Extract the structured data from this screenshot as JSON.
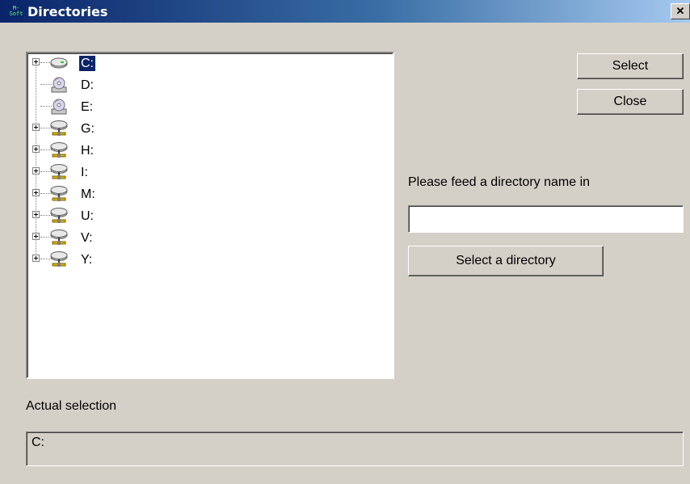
{
  "window": {
    "title": "Directories",
    "app_icon_text": "M-Soft",
    "close_glyph": "✕"
  },
  "tree": {
    "items": [
      {
        "label": "C:",
        "type": "hard-drive",
        "expandable": true,
        "selected": true
      },
      {
        "label": "D:",
        "type": "cd-drive",
        "expandable": false,
        "selected": false
      },
      {
        "label": "E:",
        "type": "cd-drive",
        "expandable": false,
        "selected": false
      },
      {
        "label": "G:",
        "type": "network-drive",
        "expandable": true,
        "selected": false
      },
      {
        "label": "H:",
        "type": "network-drive",
        "expandable": true,
        "selected": false
      },
      {
        "label": "I:",
        "type": "network-drive",
        "expandable": true,
        "selected": false
      },
      {
        "label": "M:",
        "type": "network-drive",
        "expandable": true,
        "selected": false
      },
      {
        "label": "U:",
        "type": "network-drive",
        "expandable": true,
        "selected": false
      },
      {
        "label": "V:",
        "type": "network-drive",
        "expandable": true,
        "selected": false
      },
      {
        "label": "Y:",
        "type": "network-drive",
        "expandable": true,
        "selected": false
      }
    ]
  },
  "buttons": {
    "select": "Select",
    "close": "Close",
    "select_directory": "Select a directory"
  },
  "directory_input": {
    "prompt": "Please feed a directory name in",
    "value": ""
  },
  "actual_selection": {
    "label": "Actual selection",
    "value": "C:"
  },
  "colors": {
    "title_gradient_start": "#0a246a",
    "selection_highlight": "#0a246a",
    "window_background": "#d4d0c8"
  }
}
